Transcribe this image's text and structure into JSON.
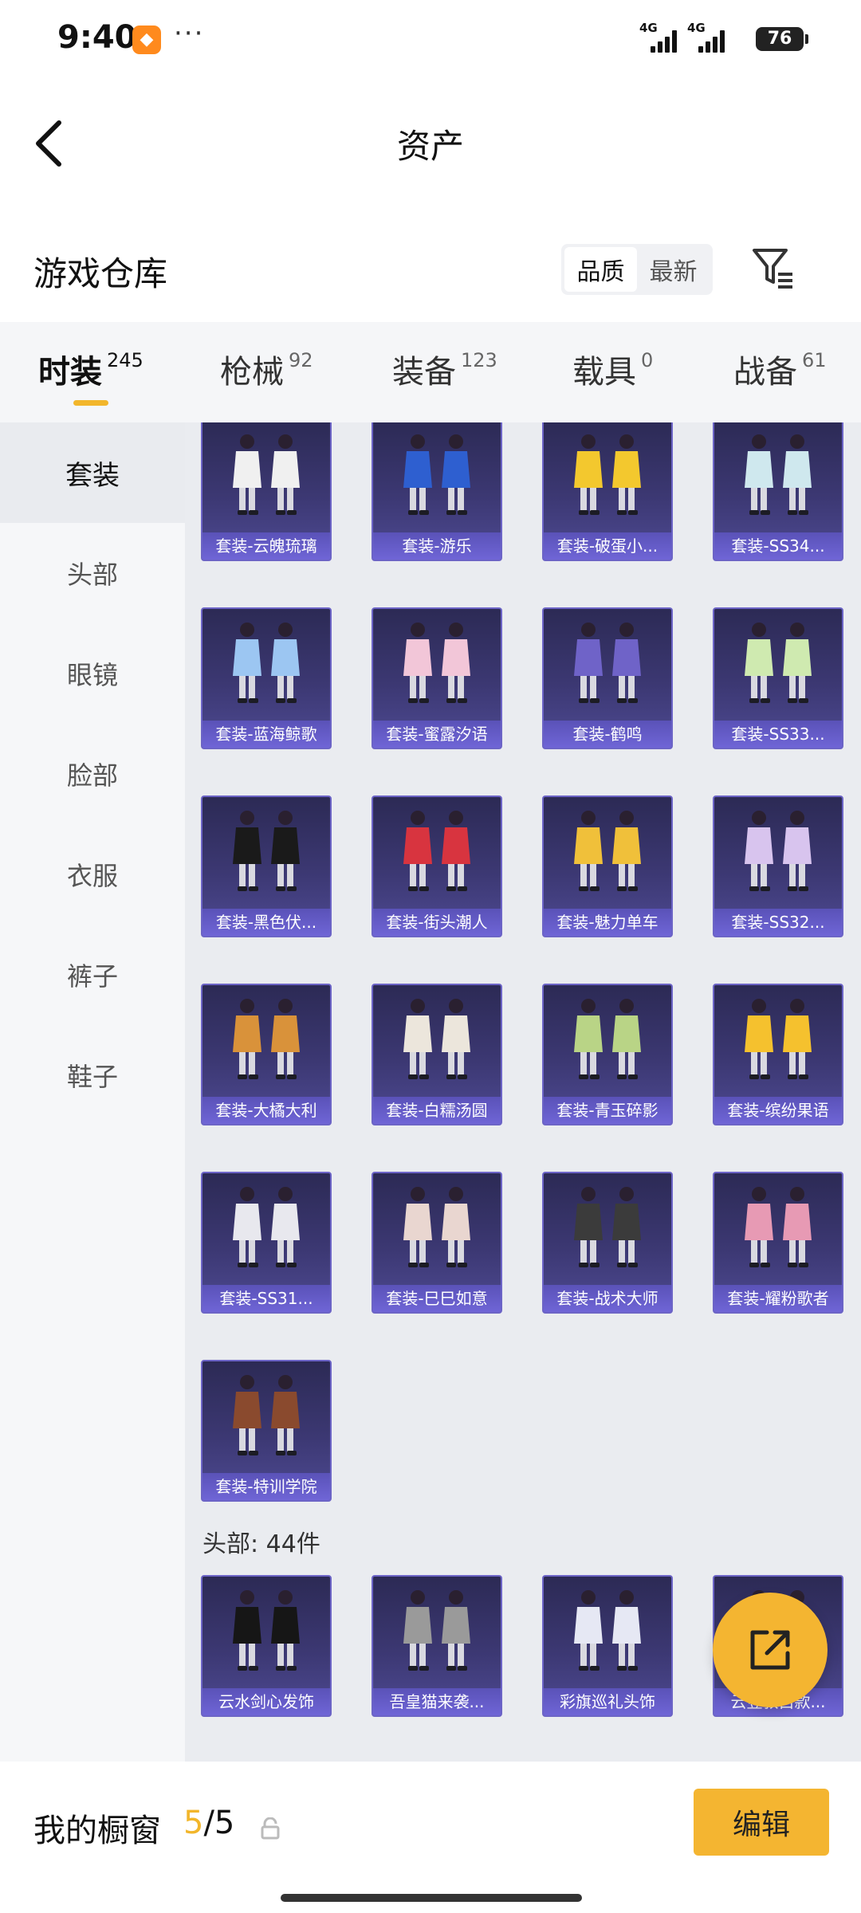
{
  "status_bar": {
    "time": "9:40",
    "app_badge_glyph": "◆",
    "network_1": "4G",
    "network_2": "4G",
    "battery": "76"
  },
  "nav": {
    "title": "资产"
  },
  "warehouse": {
    "title": "游戏仓库",
    "sort_options": [
      "品质",
      "最新"
    ],
    "active_sort": "品质"
  },
  "category_tabs": [
    {
      "name": "时装",
      "count": "245",
      "active": true
    },
    {
      "name": "枪械",
      "count": "92",
      "active": false
    },
    {
      "name": "装备",
      "count": "123",
      "active": false
    },
    {
      "name": "载具",
      "count": "0",
      "active": false
    },
    {
      "name": "战备",
      "count": "61",
      "active": false
    }
  ],
  "side_nav": [
    {
      "label": "套装",
      "active": true
    },
    {
      "label": "头部",
      "active": false
    },
    {
      "label": "眼镜",
      "active": false
    },
    {
      "label": "脸部",
      "active": false
    },
    {
      "label": "衣服",
      "active": false
    },
    {
      "label": "裤子",
      "active": false
    },
    {
      "label": "鞋子",
      "active": false
    }
  ],
  "suit_items": [
    {
      "label": "套装-云魄琉璃",
      "color": "#f0f0f0"
    },
    {
      "label": "套装-游乐",
      "color": "#2e5fd0"
    },
    {
      "label": "套装-破蛋小...",
      "color": "#f3c82e"
    },
    {
      "label": "套装-SS34...",
      "color": "#cfe8ee"
    },
    {
      "label": "套装-蓝海鲸歌",
      "color": "#9cc6f2"
    },
    {
      "label": "套装-蜜露汐语",
      "color": "#f2c6d8"
    },
    {
      "label": "套装-鹤鸣",
      "color": "#6f63c8"
    },
    {
      "label": "套装-SS33...",
      "color": "#cfeab0"
    },
    {
      "label": "套装-黑色伏...",
      "color": "#1a1a1a"
    },
    {
      "label": "套装-街头潮人",
      "color": "#d8343f"
    },
    {
      "label": "套装-魅力单车",
      "color": "#f0c03a"
    },
    {
      "label": "套装-SS32...",
      "color": "#d8c4ee"
    },
    {
      "label": "套装-大橘大利",
      "color": "#d9923a"
    },
    {
      "label": "套装-白糯汤圆",
      "color": "#ece6dc"
    },
    {
      "label": "套装-青玉碎影",
      "color": "#b9d486"
    },
    {
      "label": "套装-缤纷果语",
      "color": "#f5c12e"
    },
    {
      "label": "套装-SS31...",
      "color": "#e8e8ee"
    },
    {
      "label": "套装-巳巳如意",
      "color": "#e9d6d0"
    },
    {
      "label": "套装-战术大师",
      "color": "#3b3b3b"
    },
    {
      "label": "套装-耀粉歌者",
      "color": "#e79ab4"
    },
    {
      "label": "套装-特训学院",
      "color": "#8a4a2e"
    }
  ],
  "head_section": {
    "label": "头部: 44件",
    "items": [
      {
        "label": "云水剑心发饰",
        "color": "#161616"
      },
      {
        "label": "吾皇猫来袭...",
        "color": "#9a9a9a"
      },
      {
        "label": "彩旗巡礼头饰",
        "color": "#e6e8f4"
      },
      {
        "label": "云翌敦白款...",
        "color": "#d8453a"
      }
    ]
  },
  "bottom": {
    "showcase_label": "我的橱窗",
    "showcase_current": "5",
    "showcase_total": "/5",
    "edit_label": "编辑"
  }
}
